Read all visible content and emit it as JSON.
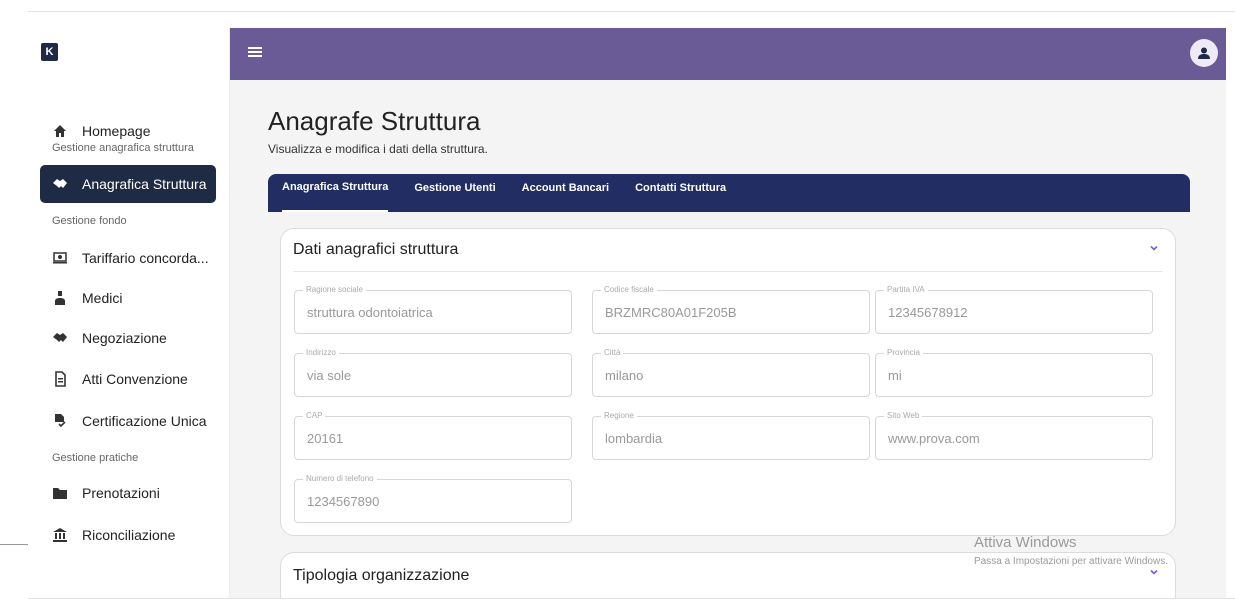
{
  "logo": "K",
  "sidebar": {
    "items": [
      {
        "label": "Homepage",
        "icon": "home-icon"
      },
      {
        "section": "Gestione anagrafica struttura"
      },
      {
        "label": "Anagrafica Struttura",
        "icon": "handshake-icon",
        "active": true
      },
      {
        "section": "Gestione fondo"
      },
      {
        "label": "Tariffario concorda...",
        "icon": "money-icon"
      },
      {
        "label": "Medici",
        "icon": "doctor-icon"
      },
      {
        "label": "Negoziazione",
        "icon": "handshake-icon"
      },
      {
        "label": "Atti Convenzione",
        "icon": "document-icon"
      },
      {
        "label": "Certificazione Unica",
        "icon": "certificate-icon"
      },
      {
        "section": "Gestione pratiche"
      },
      {
        "label": "Prenotazioni",
        "icon": "folder-icon"
      },
      {
        "label": "Riconciliazione",
        "icon": "bank-icon"
      }
    ]
  },
  "header": {
    "menu_icon": "hamburger-icon",
    "avatar_icon": "user-icon",
    "bg_color": "#6a5a96"
  },
  "page": {
    "title": "Anagrafe Struttura",
    "subtitle": "Visualizza e modifica i dati della struttura."
  },
  "tabs": [
    {
      "label": "Anagrafica Struttura",
      "active": true
    },
    {
      "label": "Gestione Utenti"
    },
    {
      "label": "Account Bancari"
    },
    {
      "label": "Contatti Struttura"
    }
  ],
  "card1": {
    "title": "Dati anagrafici struttura",
    "fields": [
      {
        "label": "Ragione sociale",
        "value": "struttura odontoiatrica"
      },
      {
        "label": "Codice fiscale",
        "value": "BRZMRC80A01F205B"
      },
      {
        "label": "Partita IVA",
        "value": "12345678912"
      },
      {
        "label": "Indirizzo",
        "value": "via sole"
      },
      {
        "label": "Città",
        "value": "milano"
      },
      {
        "label": "Provincia",
        "value": "mi"
      },
      {
        "label": "CAP",
        "value": "20161"
      },
      {
        "label": "Regione",
        "value": "lombardia"
      },
      {
        "label": "Sito Web",
        "value": "www.prova.com"
      },
      {
        "label": "Numero di telefono",
        "value": "1234567890"
      }
    ]
  },
  "card2": {
    "title": "Tipologia organizzazione"
  },
  "watermark": {
    "line1": "Attiva Windows",
    "line2": "Passa a Impostazioni per attivare Windows."
  },
  "colors": {
    "navy": "#1f2a44",
    "tabbar": "#212d63",
    "accent": "#6a5a96",
    "chevron": "#7b5bd6"
  }
}
